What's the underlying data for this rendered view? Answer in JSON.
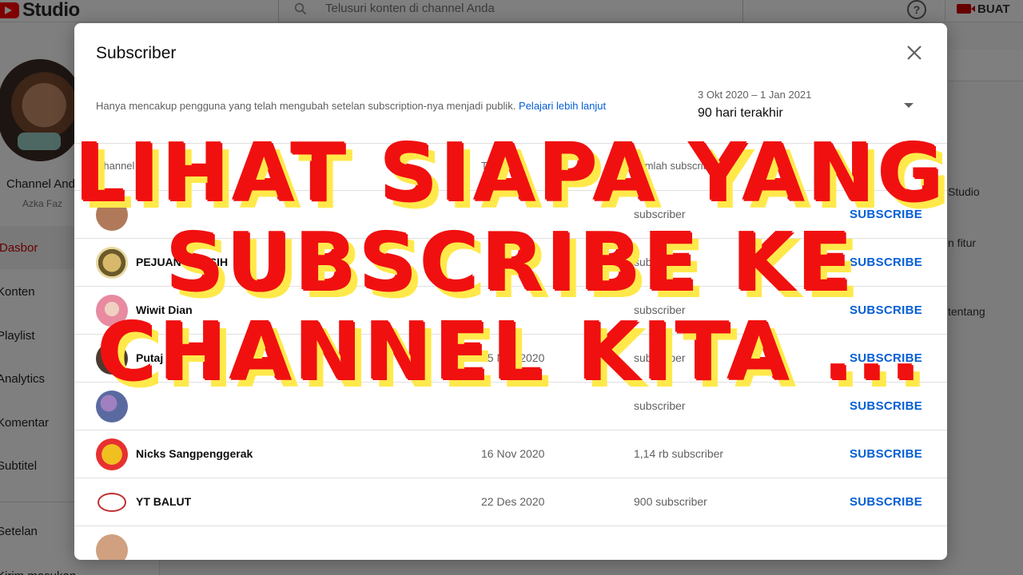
{
  "app": {
    "logo_text": "Studio",
    "search_placeholder": "Telusuri konten di channel Anda",
    "help_label": "?",
    "create_label": "BUAT"
  },
  "sidebar": {
    "channel_label": "Channel Anda",
    "channel_name": "Azka Faz",
    "items": [
      {
        "label": "Dasbor",
        "active": true
      },
      {
        "label": "Konten"
      },
      {
        "label": "Playlist"
      },
      {
        "label": "Analytics"
      },
      {
        "label": "Komentar"
      },
      {
        "label": "Subtitel"
      },
      {
        "label": "Setelan"
      },
      {
        "label": "Kirim masukan"
      }
    ]
  },
  "background_right": {
    "lines": [
      "Studio",
      "n fitur",
      "tentang"
    ]
  },
  "dialog": {
    "title": "Subscriber",
    "notice": "Hanya mencakup pengguna yang telah mengubah setelan subscription-nya menjadi publik.",
    "learn_more": "Pelajari lebih lanjut",
    "range_dates": "3 Okt 2020 – 1 Jan 2021",
    "range_value": "90 hari terakhir",
    "columns": {
      "channel": "Channel",
      "date": "Tanggal",
      "subscribers": "Jumlah subscriber"
    },
    "rows": [
      {
        "name": "",
        "date": "",
        "count": "subscriber",
        "action": "SUBSCRIBE",
        "avatar_color": "#b07a5a"
      },
      {
        "name": "PEJUANG KASIH",
        "date": "",
        "count": "subscriber",
        "action": "SUBSCRIBE",
        "avatar_color": "#9b7a3a"
      },
      {
        "name": "Wiwit Dian",
        "date": "",
        "count": "subscriber",
        "action": "SUBSCRIBE",
        "avatar_color": "#e88aa0"
      },
      {
        "name": "Putaj",
        "date": "15 Nov 2020",
        "count": "subscriber",
        "action": "SUBSCRIBE",
        "avatar_color": "#7a5a4a"
      },
      {
        "name": "",
        "date": "",
        "count": "subscriber",
        "action": "SUBSCRIBE",
        "avatar_color": "#5a6aa0"
      },
      {
        "name": "Nicks Sangpenggerak",
        "date": "16 Nov 2020",
        "count": "1,14 rb subscriber",
        "action": "SUBSCRIBE",
        "avatar_color": "#e83030"
      },
      {
        "name": "YT BALUT",
        "date": "22 Des 2020",
        "count": "900 subscriber",
        "action": "SUBSCRIBE",
        "avatar_color": "#ffffff"
      },
      {
        "name": "",
        "date": "",
        "count": "",
        "action": "",
        "avatar_color": "#d0a080"
      }
    ]
  },
  "headline": {
    "line1": "LIHAT SIAPA YANG",
    "line2": "SUBSCRIBE KE",
    "line3": "CHANNEL KITA ..."
  },
  "colors": {
    "accent_red": "#f01010",
    "shadow_yellow": "#ffe94a",
    "link_blue": "#065fd4"
  }
}
